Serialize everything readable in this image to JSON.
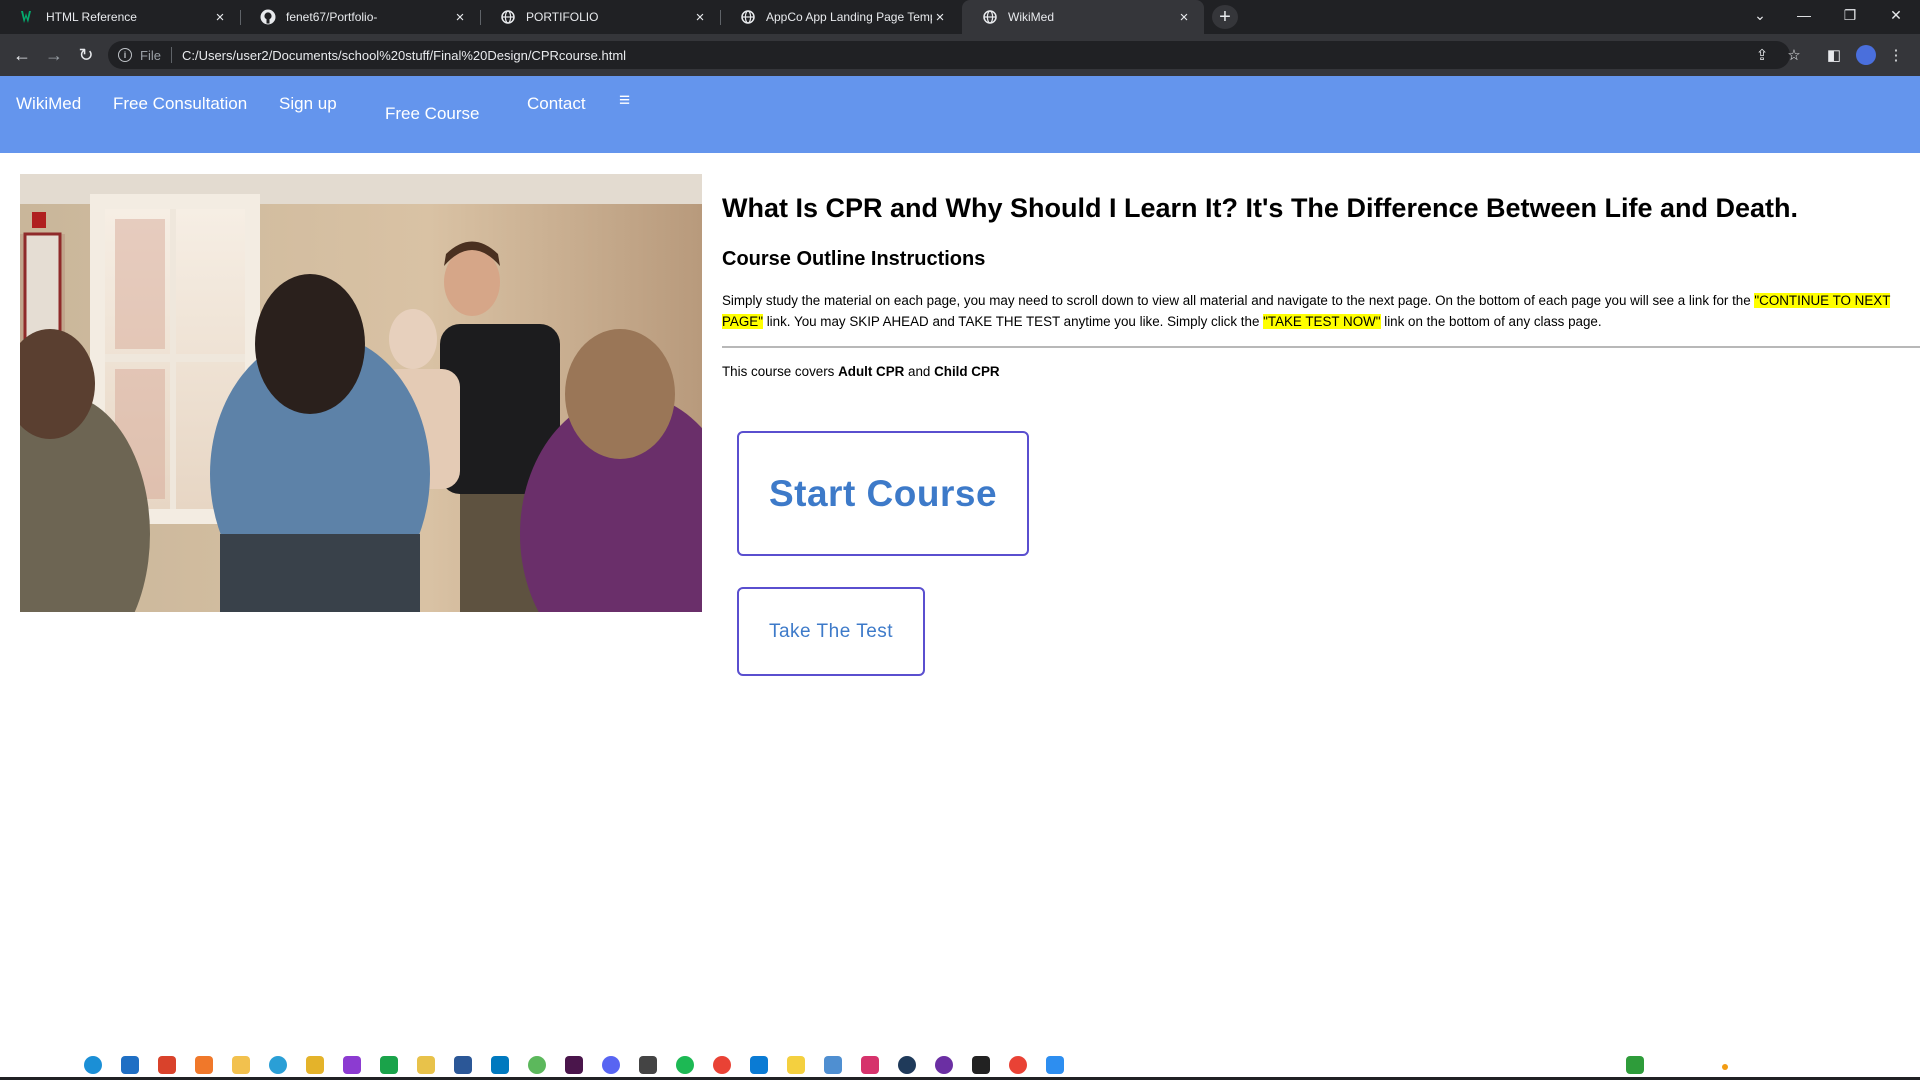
{
  "browser": {
    "tabs": [
      {
        "title": "HTML Reference",
        "icon": "w3-icon"
      },
      {
        "title": "fenet67/Portfolio-",
        "icon": "github-icon"
      },
      {
        "title": "PORTIFOLIO",
        "icon": "globe-icon"
      },
      {
        "title": "AppCo App Landing Page Templ",
        "icon": "globe-icon"
      },
      {
        "title": "WikiMed",
        "icon": "globe-icon",
        "active": true
      }
    ],
    "address": {
      "scheme_label": "File",
      "url": "C:/Users/user2/Documents/school%20stuff/Final%20Design/CPRcourse.html"
    }
  },
  "nav": {
    "brand": "WikiMed",
    "consultation": "Free Consultation",
    "signup": "Sign up",
    "course": "Free Course",
    "contact": "Contact",
    "menu_glyph": "≡"
  },
  "content": {
    "headline": "What Is CPR and Why Should I Learn It? It's The Difference Between Life and Death.",
    "subhead": "Course Outline Instructions",
    "instructions": {
      "part1": "Simply study the material on each page, you may need to scroll down to view all material and navigate to the next page. On the bottom of each page you will see a link for the ",
      "highlight1": "\"CONTINUE TO NEXT PAGE\"",
      "part2": " link. You may SKIP AHEAD and TAKE THE TEST anytime you like. Simply click the ",
      "highlight2": "\"TAKE TEST NOW\"",
      "part3": " link on the bottom of any class page."
    },
    "covers": {
      "prefix": "This course covers ",
      "adult": "Adult CPR",
      "and": " and ",
      "child": "Child CPR"
    },
    "start_button": "Start Course",
    "test_button": "Take The Test"
  },
  "colors": {
    "nav_bg": "#6495ed",
    "button_text": "#3d7ac9",
    "button_border": "#5a4fcf",
    "highlight": "#ffff00"
  }
}
